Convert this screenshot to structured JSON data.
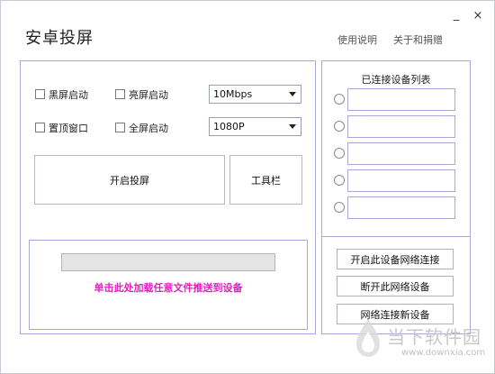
{
  "app": {
    "title": "安卓投屏",
    "links": {
      "help": "使用说明",
      "about": "关于和捐赠"
    },
    "window_controls": {
      "minimize": "_",
      "close": "×"
    }
  },
  "options": {
    "black_screen_label": "黑屏启动",
    "bright_screen_label": "亮屏启动",
    "top_window_label": "置顶窗口",
    "fullscreen_label": "全屏启动",
    "bitrate_selected": "10Mbps",
    "resolution_selected": "1080P"
  },
  "buttons": {
    "start_mirror": "开启投屏",
    "toolbar": "工具栏"
  },
  "drop_zone": {
    "progress_value": 0,
    "text": "单击此处加载任意文件推送到设备"
  },
  "devices": {
    "title": "已连接设备列表",
    "slots": [
      "",
      "",
      "",
      "",
      ""
    ],
    "open_network_label": "开启此设备网络连接",
    "disconnect_network_label": "断开此网络设备",
    "connect_new_label": "网络连接新设备"
  },
  "watermark": {
    "text": "当下软件园",
    "url": "www.downxia.com"
  }
}
